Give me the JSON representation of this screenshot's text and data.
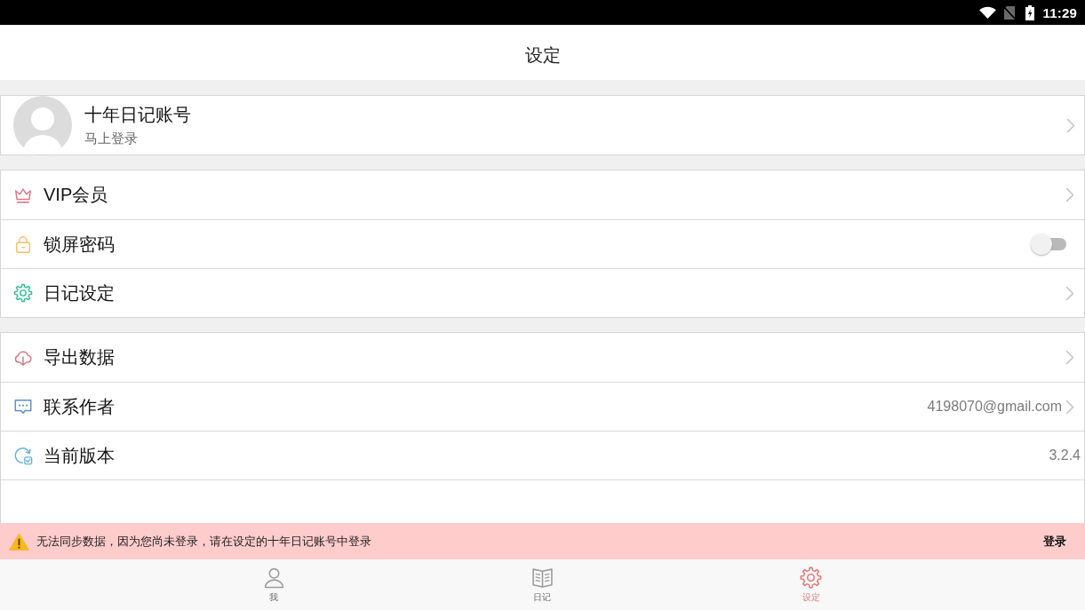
{
  "status_bar": {
    "time": "11:29"
  },
  "header": {
    "title": "设定"
  },
  "account": {
    "name": "十年日记账号",
    "subtitle": "马上登录"
  },
  "groups": [
    {
      "items": [
        {
          "kind": "link",
          "label": "VIP会员"
        },
        {
          "kind": "toggle",
          "label": "锁屏密码",
          "on": false
        },
        {
          "kind": "link",
          "label": "日记设定"
        }
      ]
    },
    {
      "items": [
        {
          "kind": "link",
          "label": "导出数据"
        },
        {
          "kind": "link",
          "label": "联系作者",
          "value": "4198070@gmail.com"
        },
        {
          "kind": "info",
          "label": "当前版本",
          "value": "3.2.4"
        }
      ]
    }
  ],
  "banner": {
    "message": "无法同步数据，因为您尚未登录，请在设定的十年日记账号中登录",
    "action": "登录"
  },
  "tabs": [
    {
      "label": "我",
      "selected": false
    },
    {
      "label": "日记",
      "selected": false
    },
    {
      "label": "设定",
      "selected": true
    }
  ]
}
